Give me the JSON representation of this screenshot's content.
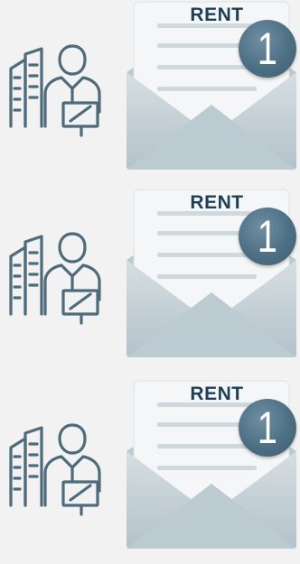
{
  "items": [
    {
      "label": "RENT",
      "count": "1",
      "icon": "person-building-icon"
    },
    {
      "label": "RENT",
      "count": "1",
      "icon": "person-building-icon"
    },
    {
      "label": "RENT",
      "count": "1",
      "icon": "person-building-icon"
    }
  ],
  "colors": {
    "background": "#f2f2f2",
    "icon_stroke": "#4e6b7c",
    "badge": "#4d6f84",
    "label_text": "#1f3f55",
    "envelope": "#c5d1d7"
  }
}
